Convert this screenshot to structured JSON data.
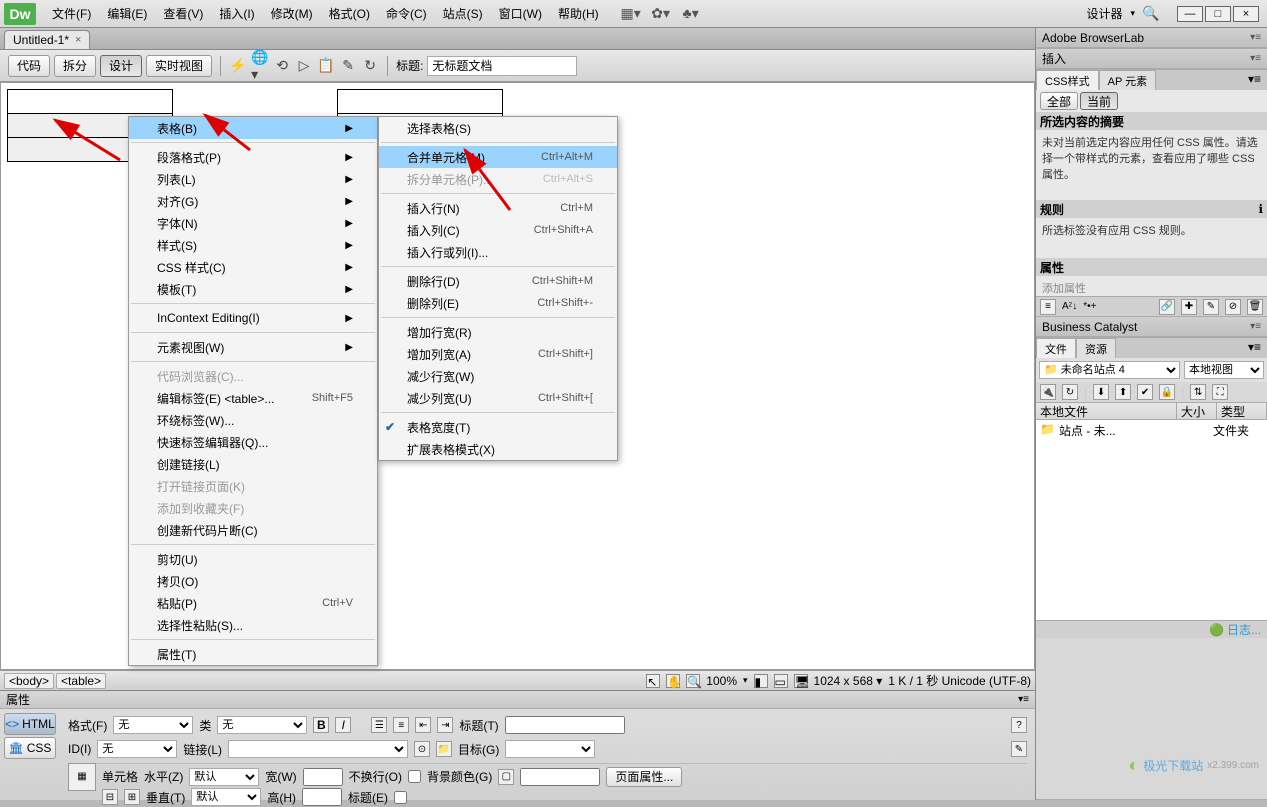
{
  "app": {
    "logo": "Dw",
    "designer_label": "设计器"
  },
  "menubar": [
    "文件(F)",
    "编辑(E)",
    "查看(V)",
    "插入(I)",
    "修改(M)",
    "格式(O)",
    "命令(C)",
    "站点(S)",
    "窗口(W)",
    "帮助(H)"
  ],
  "doc_tab": {
    "name": "Untitled-1*",
    "close": "×"
  },
  "toolbar": {
    "code": "代码",
    "split": "拆分",
    "design": "设计",
    "live": "实时视图",
    "title_lbl": "标题:",
    "title_val": "无标题文档"
  },
  "context_menu1": [
    {
      "label": "表格(B)",
      "arrow": true,
      "hl": true
    },
    {
      "sep": true
    },
    {
      "label": "段落格式(P)",
      "arrow": true
    },
    {
      "label": "列表(L)",
      "arrow": true
    },
    {
      "label": "对齐(G)",
      "arrow": true
    },
    {
      "label": "字体(N)",
      "arrow": true
    },
    {
      "label": "样式(S)",
      "arrow": true
    },
    {
      "label": "CSS 样式(C)",
      "arrow": true
    },
    {
      "label": "模板(T)",
      "arrow": true
    },
    {
      "sep": true
    },
    {
      "label": "InContext Editing(I)",
      "arrow": true
    },
    {
      "sep": true
    },
    {
      "label": "元素视图(W)",
      "arrow": true
    },
    {
      "sep": true
    },
    {
      "label": "代码浏览器(C)...",
      "disabled": true
    },
    {
      "label": "编辑标签(E) <table>...",
      "shortcut": "Shift+F5"
    },
    {
      "label": "环绕标签(W)..."
    },
    {
      "label": "快速标签编辑器(Q)..."
    },
    {
      "label": "创建链接(L)"
    },
    {
      "label": "打开链接页面(K)",
      "disabled": true
    },
    {
      "label": "添加到收藏夹(F)",
      "disabled": true
    },
    {
      "label": "创建新代码片断(C)"
    },
    {
      "sep": true
    },
    {
      "label": "剪切(U)"
    },
    {
      "label": "拷贝(O)"
    },
    {
      "label": "粘贴(P)",
      "shortcut": "Ctrl+V"
    },
    {
      "label": "选择性粘贴(S)..."
    },
    {
      "sep": true
    },
    {
      "label": "属性(T)"
    }
  ],
  "context_menu2": [
    {
      "label": "选择表格(S)"
    },
    {
      "sep": true
    },
    {
      "label": "合并单元格(M)",
      "shortcut": "Ctrl+Alt+M",
      "hl": true
    },
    {
      "label": "拆分单元格(P)...",
      "shortcut": "Ctrl+Alt+S",
      "disabled": true
    },
    {
      "sep": true
    },
    {
      "label": "插入行(N)",
      "shortcut": "Ctrl+M"
    },
    {
      "label": "插入列(C)",
      "shortcut": "Ctrl+Shift+A"
    },
    {
      "label": "插入行或列(I)..."
    },
    {
      "sep": true
    },
    {
      "label": "删除行(D)",
      "shortcut": "Ctrl+Shift+M"
    },
    {
      "label": "删除列(E)",
      "shortcut": "Ctrl+Shift+-"
    },
    {
      "sep": true
    },
    {
      "label": "增加行宽(R)"
    },
    {
      "label": "增加列宽(A)",
      "shortcut": "Ctrl+Shift+]"
    },
    {
      "label": "减少行宽(W)"
    },
    {
      "label": "减少列宽(U)",
      "shortcut": "Ctrl+Shift+["
    },
    {
      "sep": true
    },
    {
      "label": "表格宽度(T)",
      "check": true
    },
    {
      "label": "扩展表格模式(X)"
    }
  ],
  "status": {
    "tags": [
      "<body>",
      "<table>"
    ],
    "zoom": "100%",
    "dims": "1024 x 568 ▾",
    "info": "1 K / 1 秒 Unicode (UTF-8)"
  },
  "props": {
    "title": "属性",
    "tab_html": "HTML",
    "tab_css": "CSS",
    "format_lbl": "格式(F)",
    "format_val": "无",
    "class_lbl": "类",
    "class_val": "无",
    "id_lbl": "ID(I)",
    "id_val": "无",
    "link_lbl": "链接(L)",
    "link_val": "",
    "title2_lbl": "标题(T)",
    "title2_val": "",
    "target_lbl": "目标(G)",
    "target_val": "",
    "cell_lbl": "单元格",
    "hz_lbl": "水平(Z)",
    "hz_val": "默认",
    "vt_lbl": "垂直(T)",
    "vt_val": "默认",
    "w_lbl": "宽(W)",
    "w_val": "",
    "h_lbl": "高(H)",
    "h_val": "",
    "nowrap_lbl": "不换行(O)",
    "header_lbl": "标题(E)",
    "bg_lbl": "背景颜色(G)",
    "pageprops": "页面属性..."
  },
  "right": {
    "browserlab": "Adobe BrowserLab",
    "insert": "插入",
    "css_tab": "CSS样式",
    "ap_tab": "AP 元素",
    "all": "全部",
    "current": "当前",
    "summary_hdr": "所选内容的摘要",
    "summary_txt": "未对当前选定内容应用任何 CSS 属性。请选择一个带样式的元素，查看应用了哪些 CSS 属性。",
    "rules_hdr": "规则",
    "rules_txt": "所选标签没有应用 CSS 规则。",
    "props_hdr": "属性",
    "addprop": "添加属性",
    "bc": "Business Catalyst",
    "files_tab": "文件",
    "res_tab": "资源",
    "site_sel": "未命名站点 4",
    "view_sel": "本地视图",
    "col1": "本地文件",
    "col2": "大小",
    "col3": "类型",
    "row_name": "站点 - 未...",
    "row_type": "文件夹",
    "log": "日志..."
  },
  "watermark": "极光下载站"
}
